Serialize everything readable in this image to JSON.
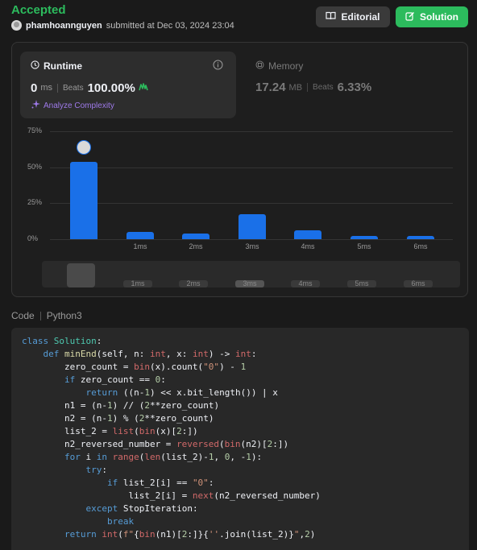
{
  "header": {
    "status": "Accepted",
    "username": "phamhoannguyen",
    "submitted_text": "submitted at Dec 03, 2024 23:04",
    "editorial_label": "Editorial",
    "solution_label": "Solution"
  },
  "runtime": {
    "title": "Runtime",
    "value": "0",
    "unit": "ms",
    "beats_label": "Beats",
    "beats_value": "100.00%",
    "analyze_label": "Analyze Complexity"
  },
  "memory": {
    "title": "Memory",
    "value": "17.24",
    "unit": "MB",
    "beats_label": "Beats",
    "beats_value": "6.33%"
  },
  "chart_data": {
    "type": "bar",
    "categories": [
      "0ms",
      "1ms",
      "2ms",
      "3ms",
      "4ms",
      "5ms",
      "6ms"
    ],
    "x_tick_labels": [
      "1ms",
      "2ms",
      "3ms",
      "4ms",
      "5ms",
      "6ms"
    ],
    "values": [
      54,
      5,
      4,
      17.5,
      6,
      2.5,
      2.5
    ],
    "ylim": [
      0,
      75
    ],
    "y_ticks": [
      "75%",
      "50%",
      "25%",
      "0%"
    ],
    "grid": true,
    "highlight_category": "0ms"
  },
  "code": {
    "label": "Code",
    "language": "Python3"
  },
  "colors": {
    "accepted": "#2cbb5d",
    "bar": "#1a70e8",
    "analyze": "#9f7aea"
  }
}
